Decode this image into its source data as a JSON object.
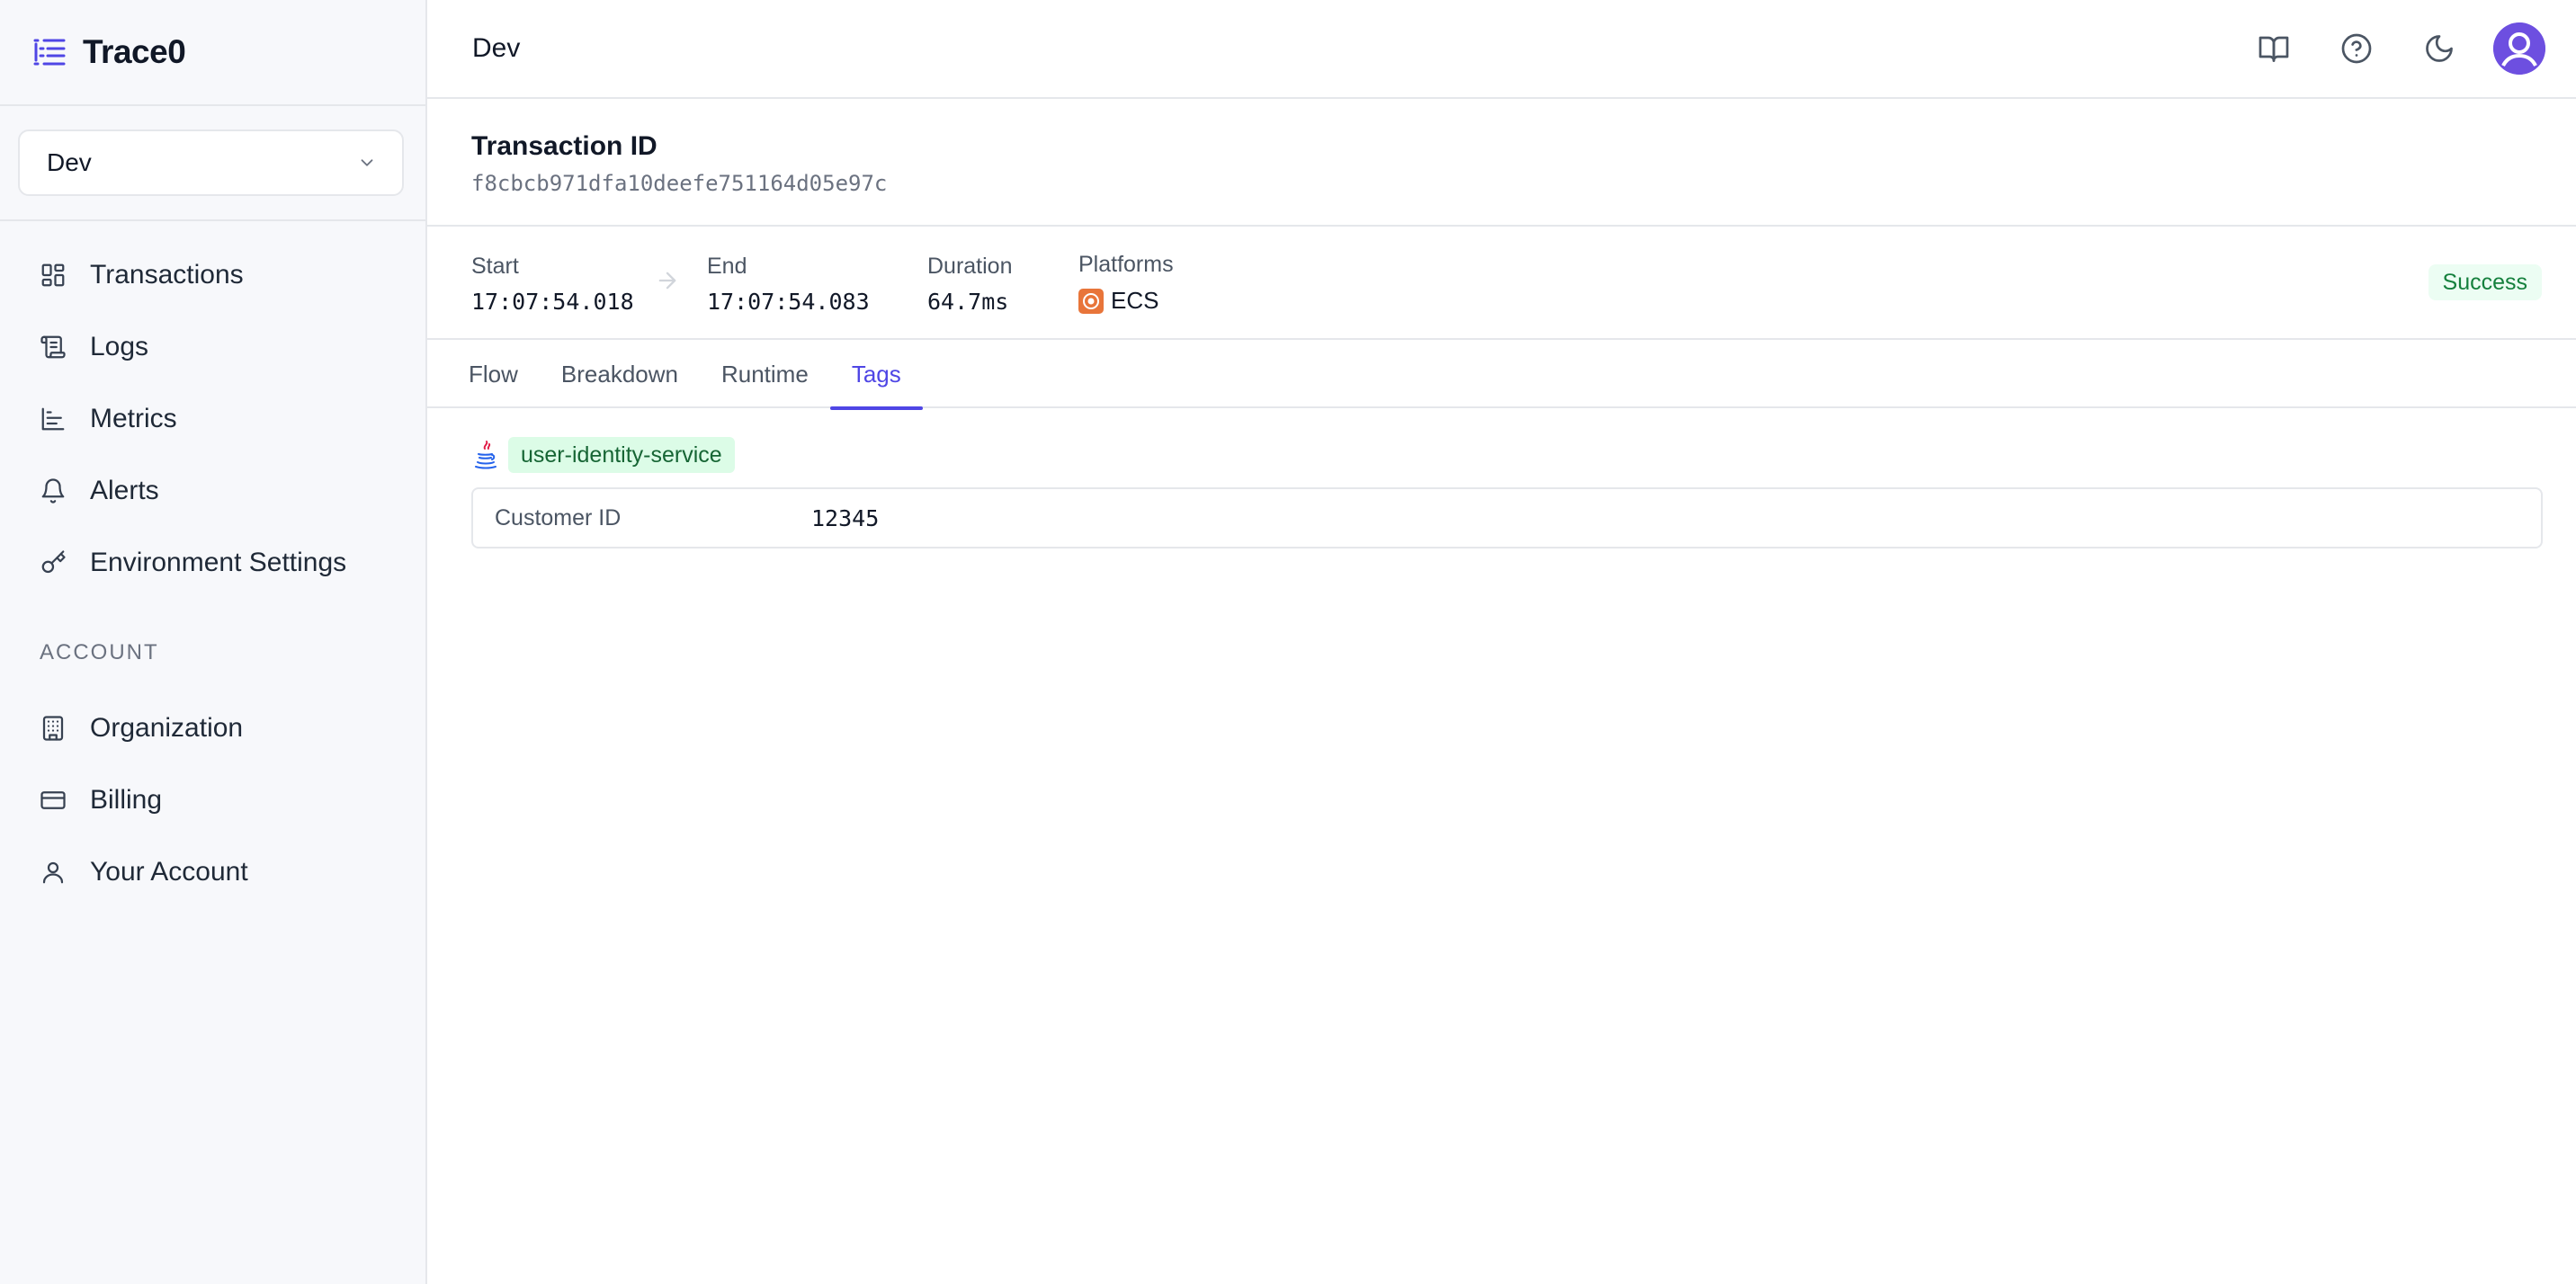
{
  "app": {
    "name": "Trace0"
  },
  "environment": {
    "selected": "Dev"
  },
  "sidebar": {
    "items": [
      {
        "label": "Transactions",
        "icon": "dashboard-grid-icon"
      },
      {
        "label": "Logs",
        "icon": "scroll-icon"
      },
      {
        "label": "Metrics",
        "icon": "bar-chart-icon"
      },
      {
        "label": "Alerts",
        "icon": "bell-icon"
      },
      {
        "label": "Environment Settings",
        "icon": "key-icon"
      }
    ],
    "account_section_label": "ACCOUNT",
    "account_items": [
      {
        "label": "Organization",
        "icon": "building-icon"
      },
      {
        "label": "Billing",
        "icon": "credit-card-icon"
      },
      {
        "label": "Your Account",
        "icon": "user-icon"
      }
    ]
  },
  "header": {
    "breadcrumb": "Dev",
    "icons": [
      "book-icon",
      "help-circle-icon",
      "moon-icon",
      "avatar"
    ]
  },
  "transaction": {
    "title": "Transaction ID",
    "id": "f8cbcb971dfa10deefe751164d05e97c",
    "start_label": "Start",
    "start_value": "17:07:54.018",
    "end_label": "End",
    "end_value": "17:07:54.083",
    "duration_label": "Duration",
    "duration_value": "64.7ms",
    "platforms_label": "Platforms",
    "platform_value": "ECS",
    "status": "Success"
  },
  "tabs": [
    {
      "label": "Flow",
      "active": false
    },
    {
      "label": "Breakdown",
      "active": false
    },
    {
      "label": "Runtime",
      "active": false
    },
    {
      "label": "Tags",
      "active": true
    }
  ],
  "tags": {
    "service_name": "user-identity-service",
    "rows": [
      {
        "key": "Customer ID",
        "value": "12345"
      }
    ]
  },
  "colors": {
    "accent": "#4f46e5",
    "success_bg": "#ecfdf3",
    "success_text": "#15803d",
    "service_bg": "#dcfce7",
    "service_text": "#166534",
    "avatar": "#6d4fe0",
    "ecs": "#e8753a"
  }
}
